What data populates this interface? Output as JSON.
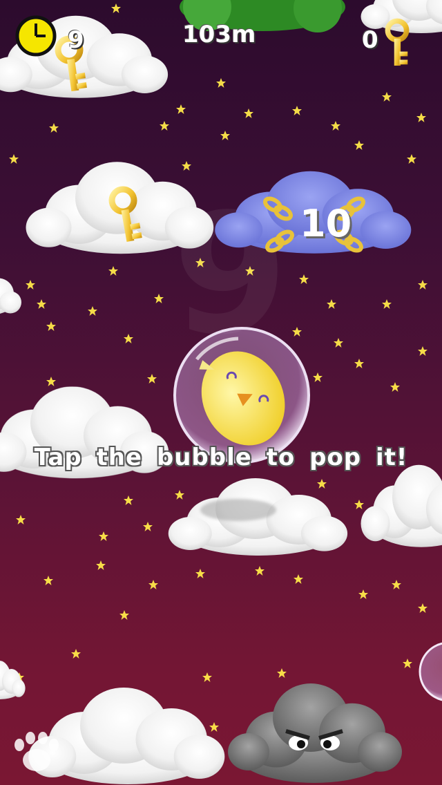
{
  "hud": {
    "timer_value": "9",
    "distance": "103m",
    "keys_collected": "0"
  },
  "cloud_counter": "10",
  "hint_text": "Tap the bubble to pop it!",
  "icons": {
    "timer": "clock-icon",
    "keys": "key-icon",
    "pause": "paw-icon"
  },
  "colors": {
    "sky_top": "#2c0b2d",
    "sky_bottom": "#7a1733",
    "clock_face": "#f5e600",
    "key_gold": "#f2c230",
    "special_cloud": "#7b86e6",
    "storm_cloud": "#7d7d7d"
  }
}
